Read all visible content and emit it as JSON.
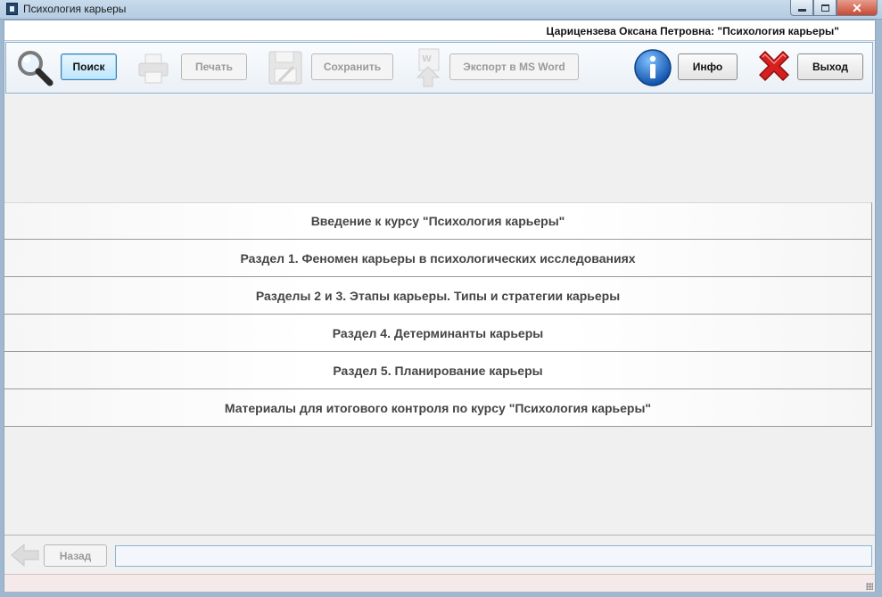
{
  "window": {
    "title": "Психология карьеры"
  },
  "header": {
    "user_title": "Царицензева Оксана Петровна: \"Психология карьеры\""
  },
  "toolbar": {
    "search_label": "Поиск",
    "print_label": "Печать",
    "save_label": "Сохранить",
    "export_label": "Экспорт в MS Word",
    "info_label": "Инфо",
    "exit_label": "Выход"
  },
  "menu": {
    "items": [
      {
        "label": "Введение к курсу \"Психология карьеры\""
      },
      {
        "label": "Раздел 1. Феномен карьеры в психологических  исследованиях"
      },
      {
        "label": "Разделы 2 и 3. Этапы карьеры. Типы и стратегии карьеры"
      },
      {
        "label": "Раздел 4. Детерминанты карьеры"
      },
      {
        "label": "Раздел 5. Планирование карьеры"
      },
      {
        "label": "Материалы для итогового контроля по курсу \"Психология карьеры\""
      }
    ]
  },
  "footer": {
    "back_label": "Назад",
    "status_value": ""
  },
  "colors": {
    "accent_blue": "#1f6fc5",
    "exit_red": "#d42020"
  }
}
